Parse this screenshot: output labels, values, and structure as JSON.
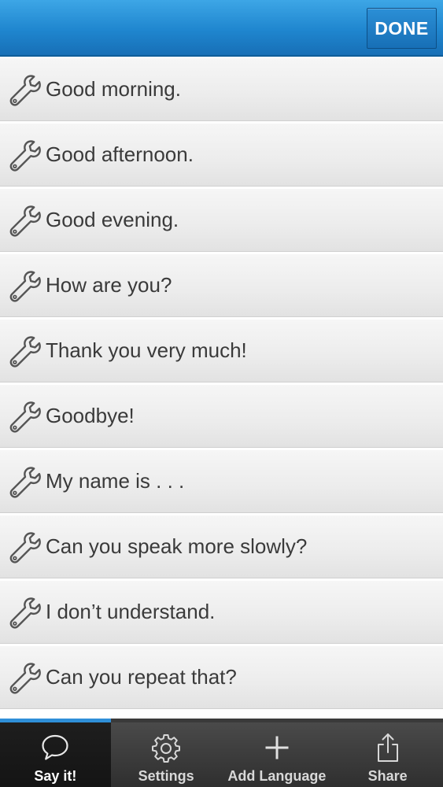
{
  "header": {
    "done_label": "DONE"
  },
  "phrases": [
    {
      "text": "Good morning.",
      "icon": "wrench-icon"
    },
    {
      "text": "Good afternoon.",
      "icon": "wrench-icon"
    },
    {
      "text": "Good evening.",
      "icon": "wrench-icon"
    },
    {
      "text": "How are you?",
      "icon": "wrench-icon"
    },
    {
      "text": "Thank you very much!",
      "icon": "wrench-icon"
    },
    {
      "text": "Goodbye!",
      "icon": "wrench-icon"
    },
    {
      "text": "My name is . . .",
      "icon": "wrench-icon"
    },
    {
      "text": "Can you speak more slowly?",
      "icon": "wrench-icon"
    },
    {
      "text": "I don’t understand.",
      "icon": "wrench-icon"
    },
    {
      "text": "Can you repeat that?",
      "icon": "wrench-icon"
    }
  ],
  "tabs": [
    {
      "label": "Say it!",
      "icon": "speech-bubble-icon",
      "active": true
    },
    {
      "label": "Settings",
      "icon": "gear-icon",
      "active": false
    },
    {
      "label": "Add Language",
      "icon": "plus-icon",
      "active": false
    },
    {
      "label": "Share",
      "icon": "share-icon",
      "active": false
    }
  ],
  "colors": {
    "header_blue": "#1f86cf",
    "active_tab_indicator": "#2f8fd8",
    "phrase_text": "#3a3a3a",
    "tab_bar": "#2f2f2f"
  }
}
